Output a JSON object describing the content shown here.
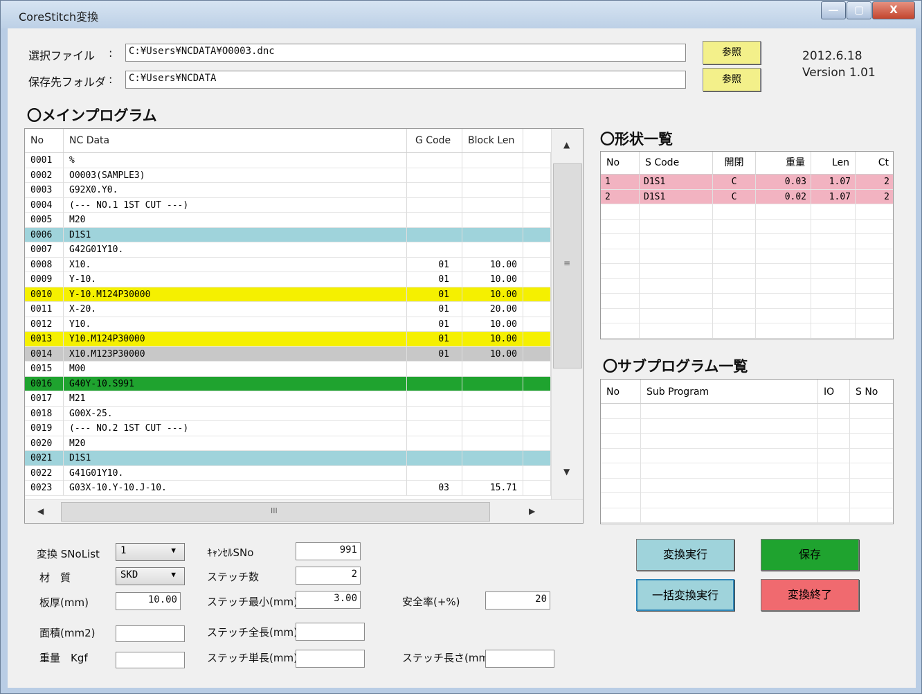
{
  "window": {
    "title": "CoreStitch変換",
    "min_label": "—",
    "max_label": "▢",
    "close_label": "X"
  },
  "header": {
    "file_label": "選択ファイル",
    "file_colon": ":",
    "file_path": "C:¥Users¥NCDATA¥O0003.dnc",
    "folder_label": "保存先フォルダ",
    "folder_colon": ":",
    "folder_path": "C:¥Users¥NCDATA",
    "browse1": "参照",
    "browse2": "参照",
    "date": "2012.6.18",
    "version": "Version 1.01"
  },
  "main_program": {
    "title": "〇メインプログラム",
    "headers": [
      "No",
      "NC Data",
      "G Code",
      "Block Len"
    ],
    "rows": [
      {
        "no": "0001",
        "nc": "%",
        "g": "",
        "b": "",
        "hl": ""
      },
      {
        "no": "0002",
        "nc": "O0003(SAMPLE3)",
        "g": "",
        "b": "",
        "hl": ""
      },
      {
        "no": "0003",
        "nc": "G92X0.Y0.",
        "g": "",
        "b": "",
        "hl": ""
      },
      {
        "no": "0004",
        "nc": "(--- NO.1 1ST CUT ---)",
        "g": "",
        "b": "",
        "hl": ""
      },
      {
        "no": "0005",
        "nc": "M20",
        "g": "",
        "b": "",
        "hl": ""
      },
      {
        "no": "0006",
        "nc": "D1S1",
        "g": "",
        "b": "",
        "hl": "#9fd3db"
      },
      {
        "no": "0007",
        "nc": "G42G01Y10.",
        "g": "",
        "b": "",
        "hl": ""
      },
      {
        "no": "0008",
        "nc": "X10.",
        "g": "01",
        "b": "10.00",
        "hl": ""
      },
      {
        "no": "0009",
        "nc": "Y-10.",
        "g": "01",
        "b": "10.00",
        "hl": ""
      },
      {
        "no": "0010",
        "nc": "Y-10.M124P30000",
        "g": "01",
        "b": "10.00",
        "hl": "#f5f000"
      },
      {
        "no": "0011",
        "nc": "X-20.",
        "g": "01",
        "b": "20.00",
        "hl": ""
      },
      {
        "no": "0012",
        "nc": "Y10.",
        "g": "01",
        "b": "10.00",
        "hl": ""
      },
      {
        "no": "0013",
        "nc": "Y10.M124P30000",
        "g": "01",
        "b": "10.00",
        "hl": "#f5f000"
      },
      {
        "no": "0014",
        "nc": "X10.M123P30000",
        "g": "01",
        "b": "10.00",
        "hl": "#c8c8c8"
      },
      {
        "no": "0015",
        "nc": "M00",
        "g": "",
        "b": "",
        "hl": ""
      },
      {
        "no": "0016",
        "nc": "G40Y-10.S991",
        "g": "",
        "b": "",
        "hl": "#1fa32f"
      },
      {
        "no": "0017",
        "nc": "M21",
        "g": "",
        "b": "",
        "hl": ""
      },
      {
        "no": "0018",
        "nc": "G00X-25.",
        "g": "",
        "b": "",
        "hl": ""
      },
      {
        "no": "0019",
        "nc": "(--- NO.2 1ST CUT ---)",
        "g": "",
        "b": "",
        "hl": ""
      },
      {
        "no": "0020",
        "nc": "M20",
        "g": "",
        "b": "",
        "hl": ""
      },
      {
        "no": "0021",
        "nc": "D1S1",
        "g": "",
        "b": "",
        "hl": "#9fd3db"
      },
      {
        "no": "0022",
        "nc": "G41G01Y10.",
        "g": "",
        "b": "",
        "hl": ""
      },
      {
        "no": "0023",
        "nc": "G03X-10.Y-10.J-10.",
        "g": "03",
        "b": "15.71",
        "hl": ""
      }
    ],
    "vscroll_grip": "≡",
    "hscroll_grip": "III"
  },
  "shapes": {
    "title": "〇形状一覧",
    "headers": [
      "No",
      "S Code",
      "開閉",
      "重量",
      "Len",
      "Ct"
    ],
    "rows": [
      {
        "no": "1",
        "s": "D1S1",
        "oc": "C",
        "w": "0.03",
        "len": "1.07",
        "ct": "2"
      },
      {
        "no": "2",
        "s": "D1S1",
        "oc": "C",
        "w": "0.02",
        "len": "1.07",
        "ct": "2"
      }
    ],
    "row_color": "#f2b3c1"
  },
  "subprograms": {
    "title": "〇サブプログラム一覧",
    "headers": [
      "No",
      "Sub Program",
      "IO",
      "S No"
    ]
  },
  "form": {
    "snolist_label": "変換 SNoList",
    "snolist_value": "1",
    "material_label": "材　質",
    "material_value": "SKD",
    "thickness_label": "板厚(mm)",
    "thickness_value": "10.00",
    "area_label": "面積(mm2)",
    "area_value": "",
    "weight_label": "重量　Kgf",
    "weight_value": "",
    "cancel_label": "ｷｬﾝｾﾙSNo",
    "cancel_value": "991",
    "stitch_count_label": "ステッチ数",
    "stitch_count_value": "2",
    "stitch_min_label": "ステッチ最小(mm)",
    "stitch_min_value": "3.00",
    "stitch_total_label": "ステッチ全長(mm)",
    "stitch_total_value": "",
    "stitch_unit_label": "ステッチ単長(mm)",
    "stitch_unit_value": "",
    "safety_label": "安全率(+%)",
    "safety_value": "20",
    "stitch_len_label": "ステッチ長さ(mm)",
    "stitch_len_value": ""
  },
  "actions": {
    "convert": "変換実行",
    "convert_color": "#9fd3db",
    "save": "保存",
    "save_color": "#1fa32f",
    "batch": "一括変換実行",
    "batch_color": "#9fd3db",
    "exit": "変換終了",
    "exit_color": "#f06a6f"
  }
}
